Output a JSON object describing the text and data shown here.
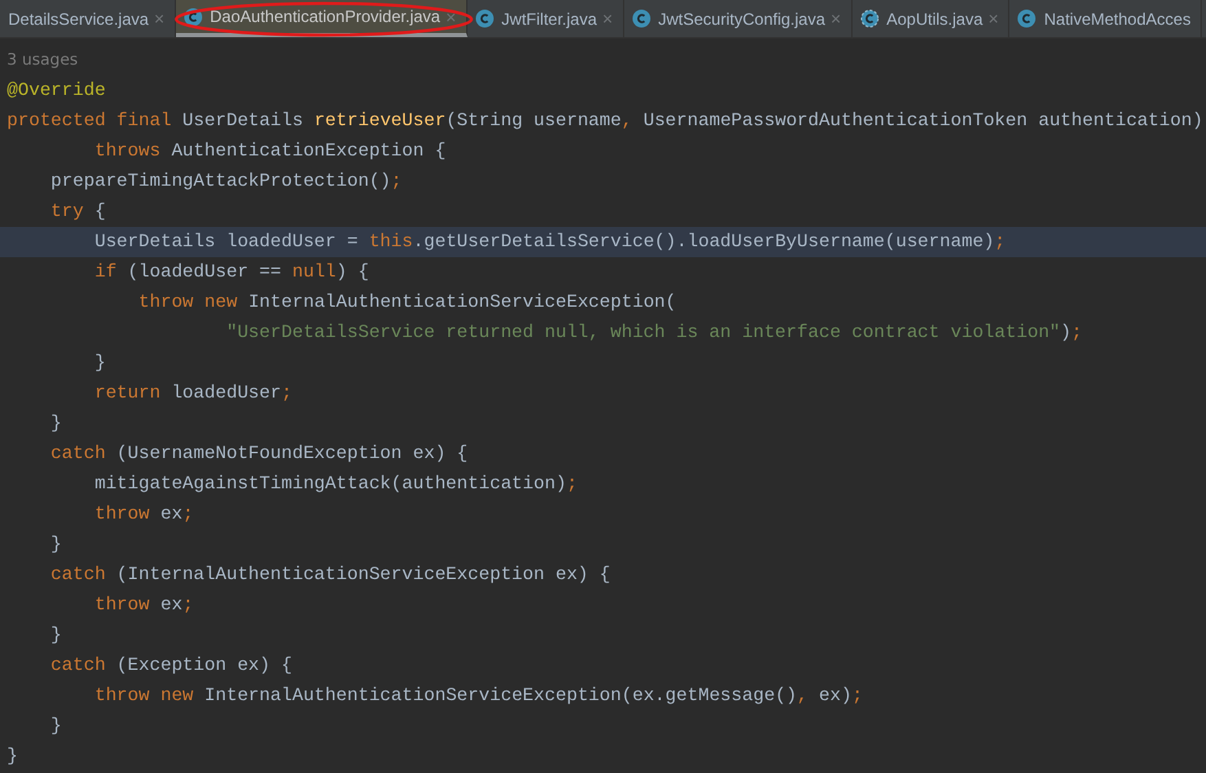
{
  "tabs": [
    {
      "label": "DetailsService.java",
      "kind": "none",
      "selected": false,
      "circled": false,
      "close": "×"
    },
    {
      "label": "DaoAuthenticationProvider.java",
      "kind": "class",
      "selected": true,
      "circled": true,
      "close": "×"
    },
    {
      "label": "JwtFilter.java",
      "kind": "class",
      "selected": false,
      "circled": false,
      "close": "×"
    },
    {
      "label": "JwtSecurityConfig.java",
      "kind": "class",
      "selected": false,
      "circled": false,
      "close": "×"
    },
    {
      "label": "AopUtils.java",
      "kind": "abstract",
      "selected": false,
      "circled": false,
      "close": "×"
    },
    {
      "label": "NativeMethodAcces",
      "kind": "class",
      "selected": false,
      "circled": false
    }
  ],
  "editor": {
    "usages": "3 usages",
    "lines": [
      {
        "highlighted": false,
        "tokens": [
          {
            "kind": "ann",
            "t": "@Override"
          }
        ]
      },
      {
        "highlighted": false,
        "tokens": [
          {
            "kind": "kw",
            "t": "protected final "
          },
          {
            "kind": "plain",
            "t": "UserDetails "
          },
          {
            "kind": "fn",
            "t": "retrieveUser"
          },
          {
            "kind": "plain",
            "t": "(String username"
          },
          {
            "kind": "kw",
            "t": ", "
          },
          {
            "kind": "plain",
            "t": "UsernamePasswordAuthenticationToken authentication)"
          }
        ]
      },
      {
        "highlighted": false,
        "tokens": [
          {
            "kind": "kw",
            "t": "        throws "
          },
          {
            "kind": "plain",
            "t": "AuthenticationException {"
          }
        ]
      },
      {
        "highlighted": false,
        "tokens": [
          {
            "kind": "plain",
            "t": "    prepareTimingAttackProtection()"
          },
          {
            "kind": "kw",
            "t": ";"
          }
        ]
      },
      {
        "highlighted": false,
        "tokens": [
          {
            "kind": "kw",
            "t": "    try "
          },
          {
            "kind": "plain",
            "t": "{"
          }
        ]
      },
      {
        "highlighted": true,
        "tokens": [
          {
            "kind": "plain",
            "t": "        UserDetails loadedUser = "
          },
          {
            "kind": "kw",
            "t": "this"
          },
          {
            "kind": "plain",
            "t": ".getUserDetailsService().loadUserByUsername(username)"
          },
          {
            "kind": "kw",
            "t": ";"
          }
        ]
      },
      {
        "highlighted": false,
        "tokens": [
          {
            "kind": "kw",
            "t": "        if "
          },
          {
            "kind": "plain",
            "t": "(loadedUser == "
          },
          {
            "kind": "kw",
            "t": "null"
          },
          {
            "kind": "plain",
            "t": ") {"
          }
        ]
      },
      {
        "highlighted": false,
        "tokens": [
          {
            "kind": "kw",
            "t": "            throw new "
          },
          {
            "kind": "plain",
            "t": "InternalAuthenticationServiceException("
          }
        ]
      },
      {
        "highlighted": false,
        "tokens": [
          {
            "kind": "str",
            "t": "                    \"UserDetailsService returned null, which is an interface contract violation\""
          },
          {
            "kind": "plain",
            "t": ")"
          },
          {
            "kind": "kw",
            "t": ";"
          }
        ]
      },
      {
        "highlighted": false,
        "tokens": [
          {
            "kind": "plain",
            "t": "        }"
          }
        ]
      },
      {
        "highlighted": false,
        "tokens": [
          {
            "kind": "kw",
            "t": "        return "
          },
          {
            "kind": "plain",
            "t": "loadedUser"
          },
          {
            "kind": "kw",
            "t": ";"
          }
        ]
      },
      {
        "highlighted": false,
        "tokens": [
          {
            "kind": "plain",
            "t": "    }"
          }
        ]
      },
      {
        "highlighted": false,
        "tokens": [
          {
            "kind": "kw",
            "t": "    catch "
          },
          {
            "kind": "plain",
            "t": "(UsernameNotFoundException ex) {"
          }
        ]
      },
      {
        "highlighted": false,
        "tokens": [
          {
            "kind": "plain",
            "t": "        mitigateAgainstTimingAttack(authentication)"
          },
          {
            "kind": "kw",
            "t": ";"
          }
        ]
      },
      {
        "highlighted": false,
        "tokens": [
          {
            "kind": "kw",
            "t": "        throw "
          },
          {
            "kind": "plain",
            "t": "ex"
          },
          {
            "kind": "kw",
            "t": ";"
          }
        ]
      },
      {
        "highlighted": false,
        "tokens": [
          {
            "kind": "plain",
            "t": "    }"
          }
        ]
      },
      {
        "highlighted": false,
        "tokens": [
          {
            "kind": "kw",
            "t": "    catch "
          },
          {
            "kind": "plain",
            "t": "(InternalAuthenticationServiceException ex) {"
          }
        ]
      },
      {
        "highlighted": false,
        "tokens": [
          {
            "kind": "kw",
            "t": "        throw "
          },
          {
            "kind": "plain",
            "t": "ex"
          },
          {
            "kind": "kw",
            "t": ";"
          }
        ]
      },
      {
        "highlighted": false,
        "tokens": [
          {
            "kind": "plain",
            "t": "    }"
          }
        ]
      },
      {
        "highlighted": false,
        "tokens": [
          {
            "kind": "kw",
            "t": "    catch "
          },
          {
            "kind": "plain",
            "t": "(Exception ex) {"
          }
        ]
      },
      {
        "highlighted": false,
        "tokens": [
          {
            "kind": "kw",
            "t": "        throw new "
          },
          {
            "kind": "plain",
            "t": "InternalAuthenticationServiceException(ex.getMessage()"
          },
          {
            "kind": "kw",
            "t": ", "
          },
          {
            "kind": "plain",
            "t": "ex)"
          },
          {
            "kind": "kw",
            "t": ";"
          }
        ]
      },
      {
        "highlighted": false,
        "tokens": [
          {
            "kind": "plain",
            "t": "    }"
          }
        ]
      },
      {
        "highlighted": false,
        "tokens": [
          {
            "kind": "plain",
            "t": "}"
          }
        ]
      }
    ]
  }
}
